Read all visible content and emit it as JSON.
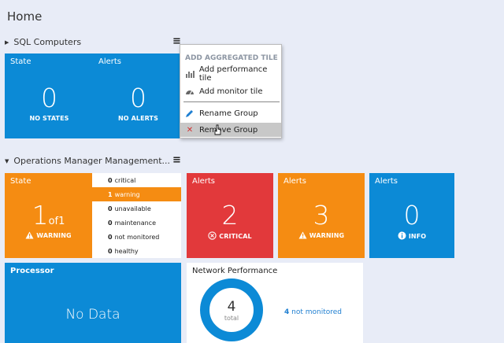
{
  "page": {
    "title": "Home"
  },
  "groups": [
    {
      "name": "SQL Computers",
      "tile": {
        "state_label": "State",
        "alerts_label": "Alerts",
        "state_value": "0",
        "state_caption": "NO STATES",
        "alerts_value": "0",
        "alerts_caption": "NO ALERTS"
      }
    },
    {
      "name": "Operations Manager Management...",
      "state_tile": {
        "label": "State",
        "value_main": "1",
        "value_of": "of1",
        "caption": "WARNING"
      },
      "state_list": [
        {
          "count": "0",
          "label": "critical"
        },
        {
          "count": "1",
          "label": "warning"
        },
        {
          "count": "0",
          "label": "unavailable"
        },
        {
          "count": "0",
          "label": "maintenance"
        },
        {
          "count": "0",
          "label": "not monitored"
        },
        {
          "count": "0",
          "label": "healthy"
        }
      ],
      "alert_tiles": [
        {
          "label": "Alerts",
          "value": "2",
          "caption": "CRITICAL"
        },
        {
          "label": "Alerts",
          "value": "3",
          "caption": "WARNING"
        },
        {
          "label": "Alerts",
          "value": "0",
          "caption": "INFO"
        }
      ],
      "processor_tile": {
        "label": "Processor",
        "text": "No Data"
      },
      "network_tile": {
        "label": "Network Performance",
        "total_value": "4",
        "total_label": "total",
        "legend_count": "4",
        "legend_label": "not monitored",
        "ring_color": "#0c8ad6",
        "not_monitored_fraction": 1.0
      }
    }
  ],
  "context_menu": {
    "header": "ADD AGGREGATED TILE",
    "items": [
      {
        "label": "Add performance tile",
        "icon": "bar-chart-icon"
      },
      {
        "label": "Add monitor tile",
        "icon": "gauge-icon"
      },
      {
        "label": "Rename Group",
        "icon": "pencil-icon"
      },
      {
        "label": "Remove Group",
        "icon": "red-x-icon"
      }
    ]
  },
  "colors": {
    "blue": "#0c8ad6",
    "orange": "#f58c12",
    "red": "#e2393b",
    "background": "#e8ecf7"
  }
}
